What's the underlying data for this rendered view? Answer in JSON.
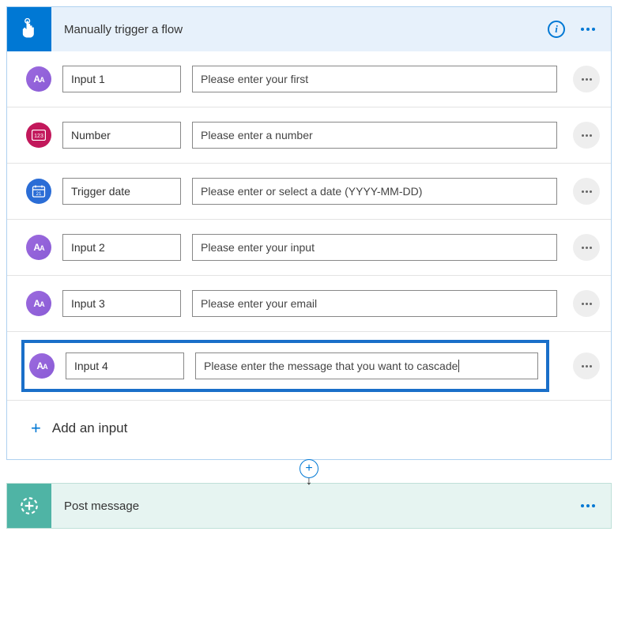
{
  "trigger": {
    "title": "Manually trigger a flow",
    "add_input_label": "Add an input",
    "inputs": [
      {
        "icon": "text",
        "name": "Input 1",
        "placeholder": "Please enter your first",
        "highlighted": false
      },
      {
        "icon": "number",
        "name": "Number",
        "placeholder": "Please enter a number",
        "highlighted": false
      },
      {
        "icon": "date",
        "name": "Trigger date",
        "placeholder": "Please enter or select a date (YYYY-MM-DD)",
        "highlighted": false
      },
      {
        "icon": "text",
        "name": "Input 2",
        "placeholder": "Please enter your input",
        "highlighted": false
      },
      {
        "icon": "text",
        "name": "Input 3",
        "placeholder": "Please enter your email",
        "highlighted": false
      },
      {
        "icon": "text",
        "name": "Input 4",
        "placeholder": "Please enter the message that you want to cascade",
        "highlighted": true
      }
    ]
  },
  "action": {
    "title": "Post message"
  }
}
